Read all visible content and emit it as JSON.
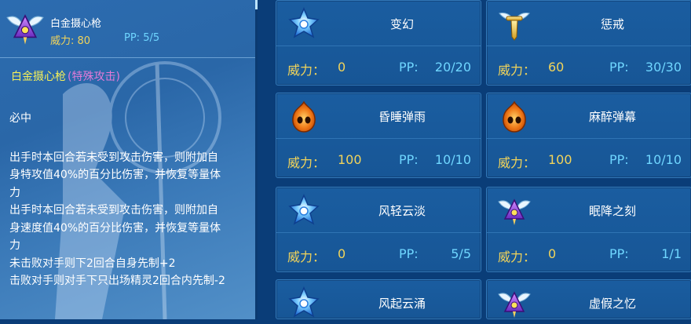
{
  "detail": {
    "name": "白金摄心枪",
    "power": "威力: 80",
    "pp": "PP: 5/5",
    "title": "白金摄心枪",
    "category": "(特殊攻击)",
    "lines": [
      "必中",
      "出手时本回合若未受到攻击伤害，则附加自",
      "身特攻值40%的百分比伤害，并恢复等量体",
      "力",
      "出手时本回合若未受到攻击伤害，则附加自",
      "身速度值40%的百分比伤害，并恢复等量体",
      "力",
      "未击败对手则下2回合自身先制+2",
      "击败对手则对手下只出场精灵2回合内先制-2"
    ]
  },
  "labels": {
    "power": "威力：",
    "pp": "PP:"
  },
  "skills": [
    {
      "name": "变幻",
      "power": "0",
      "pp": "20/20",
      "icon": "blue-star-icon"
    },
    {
      "name": "惩戒",
      "power": "60",
      "pp": "30/30",
      "icon": "golden-winged-sword-icon"
    },
    {
      "name": "昏睡弹雨",
      "power": "100",
      "pp": "10/10",
      "icon": "orange-flame-icon"
    },
    {
      "name": "麻醉弹幕",
      "power": "100",
      "pp": "10/10",
      "icon": "orange-flame-icon"
    },
    {
      "name": "风轻云淡",
      "power": "0",
      "pp": "5/5",
      "icon": "blue-star-icon"
    },
    {
      "name": "眠降之刻",
      "power": "0",
      "pp": "1/1",
      "icon": "purple-winged-eye-icon"
    },
    {
      "name": "风起云涌",
      "power": "",
      "pp": "",
      "icon": "blue-star-icon"
    },
    {
      "name": "虚假之忆",
      "power": "",
      "pp": "",
      "icon": "purple-winged-eye-icon"
    }
  ],
  "colors": {
    "power": "#f2d45a",
    "pp": "#6fd6ff",
    "skill_title": "#f4ef5a",
    "category": "#e27ad8",
    "card_bg": "#1a5da0"
  }
}
